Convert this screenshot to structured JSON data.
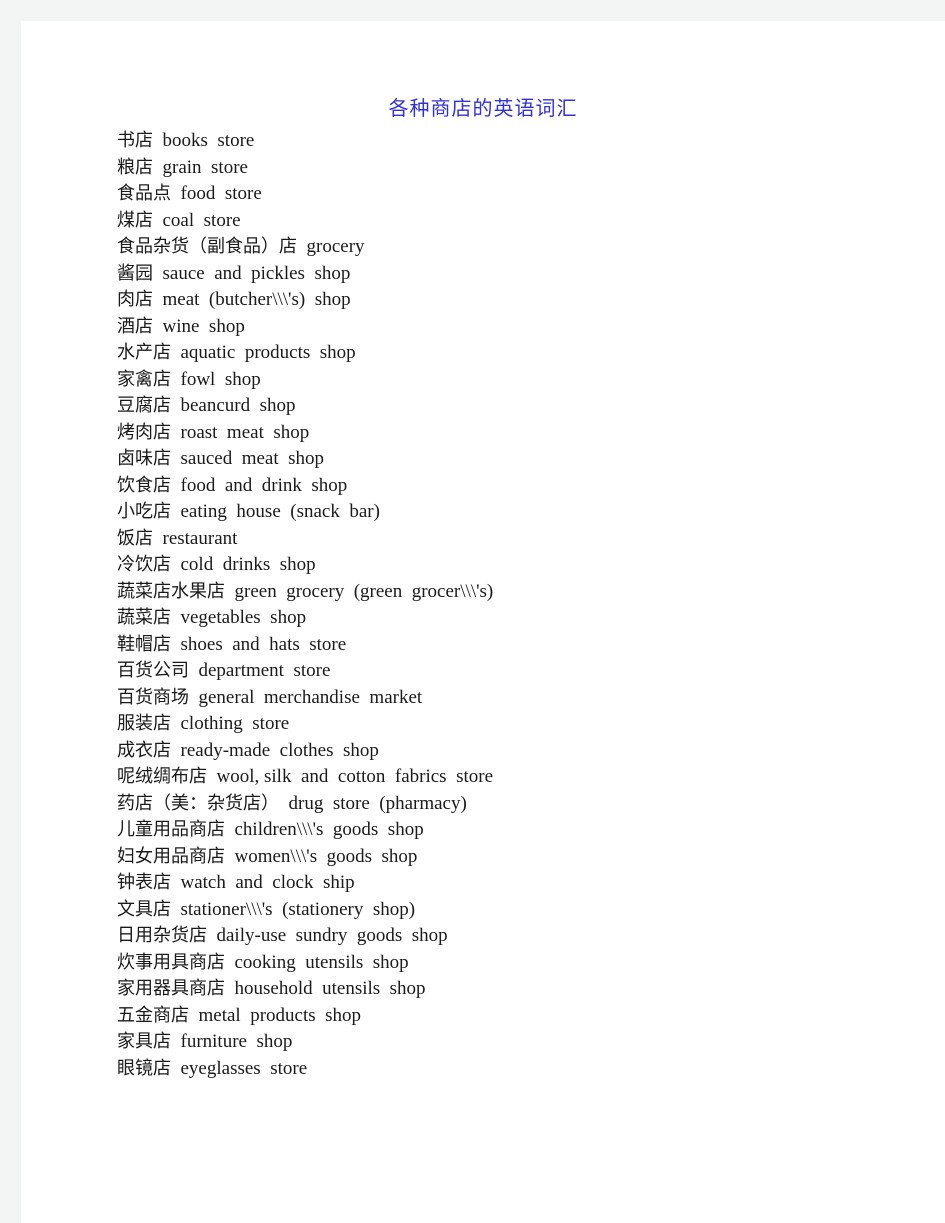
{
  "document": {
    "title": "各种商店的英语词汇",
    "title_color": "#3333cc",
    "body_color": "#1a1a1a",
    "page_background": "#ffffff",
    "frame_color": "#f3f4f4"
  },
  "entries": [
    {
      "cn": "书店",
      "en": "books  store"
    },
    {
      "cn": "粮店",
      "en": "grain  store"
    },
    {
      "cn": "食品点",
      "en": "food  store"
    },
    {
      "cn": "煤店",
      "en": "coal  store"
    },
    {
      "cn": "食品杂货（副食品）店",
      "en": "grocery"
    },
    {
      "cn": "酱园",
      "en": "sauce  and  pickles  shop"
    },
    {
      "cn": "肉店",
      "en": "meat  (butcher\\\\\\'s)  shop"
    },
    {
      "cn": "酒店",
      "en": "wine  shop"
    },
    {
      "cn": "水产店",
      "en": "aquatic  products  shop"
    },
    {
      "cn": "家禽店",
      "en": "fowl  shop"
    },
    {
      "cn": "豆腐店",
      "en": "beancurd  shop"
    },
    {
      "cn": "烤肉店",
      "en": "roast  meat  shop"
    },
    {
      "cn": "卤味店",
      "en": "sauced  meat  shop"
    },
    {
      "cn": "饮食店",
      "en": "food  and  drink  shop"
    },
    {
      "cn": "小吃店",
      "en": "eating  house  (snack  bar)"
    },
    {
      "cn": "饭店",
      "en": "restaurant"
    },
    {
      "cn": "冷饮店",
      "en": "cold  drinks  shop"
    },
    {
      "cn": "蔬菜店水果店",
      "en": "green  grocery  (green  grocer\\\\\\'s)"
    },
    {
      "cn": "蔬菜店",
      "en": "vegetables  shop"
    },
    {
      "cn": "鞋帽店",
      "en": "shoes  and  hats  store"
    },
    {
      "cn": "百货公司",
      "en": "department  store"
    },
    {
      "cn": "百货商场",
      "en": "general  merchandise  market"
    },
    {
      "cn": "服装店",
      "en": "clothing  store"
    },
    {
      "cn": "成衣店",
      "en": "ready-made  clothes  shop"
    },
    {
      "cn": "呢绒绸布店",
      "en": "wool, silk  and  cotton  fabrics  store"
    },
    {
      "cn": "药店（美：杂货店）",
      "en": "drug  store  (pharmacy)"
    },
    {
      "cn": "儿童用品商店",
      "en": "children\\\\\\'s  goods  shop"
    },
    {
      "cn": "妇女用品商店",
      "en": "women\\\\\\'s  goods  shop"
    },
    {
      "cn": "钟表店",
      "en": "watch  and  clock  ship"
    },
    {
      "cn": "文具店",
      "en": "stationer\\\\\\'s  (stationery  shop)"
    },
    {
      "cn": "日用杂货店",
      "en": "daily-use  sundry  goods  shop"
    },
    {
      "cn": "炊事用具商店",
      "en": "cooking  utensils  shop"
    },
    {
      "cn": "家用器具商店",
      "en": "household  utensils  shop"
    },
    {
      "cn": "五金商店",
      "en": "metal  products  shop"
    },
    {
      "cn": "家具店",
      "en": "furniture  shop"
    },
    {
      "cn": "眼镜店",
      "en": "eyeglasses  store"
    }
  ]
}
